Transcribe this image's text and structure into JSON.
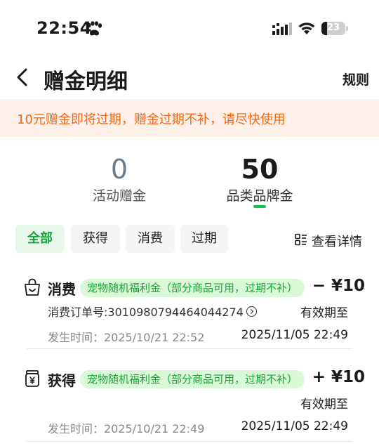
{
  "status_bar": {
    "time": "22:54",
    "battery": "23",
    "battery_level": 0.23
  },
  "header": {
    "title": "赠金明细",
    "rules_label": "规则"
  },
  "notice": {
    "text": "10元赠金即将过期，赠金过期不补，请尽快使用"
  },
  "summary": {
    "activity": {
      "value": "0",
      "label": "活动赠金"
    },
    "category": {
      "value": "50",
      "label": "品类品牌金"
    }
  },
  "filters": {
    "tabs": [
      {
        "label": "全部",
        "active": true
      },
      {
        "label": "获得",
        "active": false
      },
      {
        "label": "消费",
        "active": false
      },
      {
        "label": "过期",
        "active": false
      }
    ],
    "details_label": "查看详情"
  },
  "records": [
    {
      "type": "消费",
      "icon": "shopping-bag-icon",
      "tag": "宠物随机福利金（部分商品可用，过期不补）",
      "amount": "− ¥10",
      "order": "消费订单号:3010980794464044274",
      "expiry_label": "有效期至",
      "time": "发生时间：2025/10/21 22:52",
      "expiry_date": "2025/11/05 22:49"
    },
    {
      "type": "获得",
      "icon": "coin-jar-icon",
      "tag": "宠物随机福利金（部分商品可用，过期不补）",
      "amount": "+ ¥10",
      "expiry_label": "有效期至",
      "time": "发生时间：2025/10/21 22:49",
      "expiry_date": "2025/11/05 22:49"
    }
  ],
  "colors": {
    "accent_green": "#16c24a",
    "notice_orange": "#ee6a1a",
    "notice_bg": "#fdf0e8"
  }
}
